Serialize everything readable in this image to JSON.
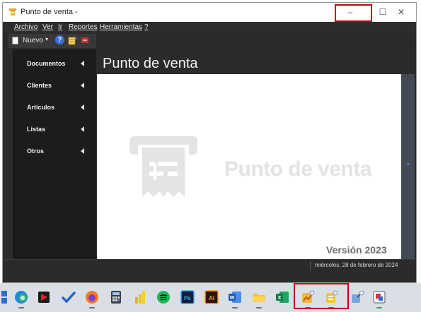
{
  "window": {
    "title": "Punto de venta -",
    "controls": {
      "minimize": "–",
      "maximize": "☐",
      "close": "✕"
    }
  },
  "menu": {
    "items": [
      "Archivo",
      "Ver",
      "Ir",
      "Reportes",
      "Herramientas",
      "?"
    ]
  },
  "toolbar": {
    "new_label": "Nuevo",
    "new_caret": "▾",
    "help_glyph": "?"
  },
  "sidebar": {
    "items": [
      {
        "label": "Documentos"
      },
      {
        "label": "Clientes"
      },
      {
        "label": "Artículos"
      },
      {
        "label": "Listas"
      },
      {
        "label": "Otros"
      }
    ]
  },
  "main": {
    "title": "Punto de venta",
    "brand_text": "Punto de venta",
    "version": "Versión 2023"
  },
  "status": {
    "date": "miércoles, 28 de febrero de 2024"
  },
  "taskbar": {
    "icons": [
      "windows-start-icon",
      "edge-icon",
      "media-player-icon",
      "todo-check-icon",
      "firefox-icon",
      "calculator-icon",
      "power-bi-icon",
      "spotify-icon",
      "photoshop-icon",
      "illustrator-icon",
      "word-icon",
      "file-explorer-icon",
      "excel-icon",
      "punto-venta-app-icon-1",
      "punto-venta-app-icon-2",
      "remote-tool-icon",
      "snipping-tool-icon"
    ]
  },
  "colors": {
    "highlight": "#c0000a",
    "sidebar_bg": "#1c1c1c",
    "window_bg": "#2b2b2b",
    "brand_watermark": "#e3e3e3",
    "version_text": "#6d6d6d"
  }
}
